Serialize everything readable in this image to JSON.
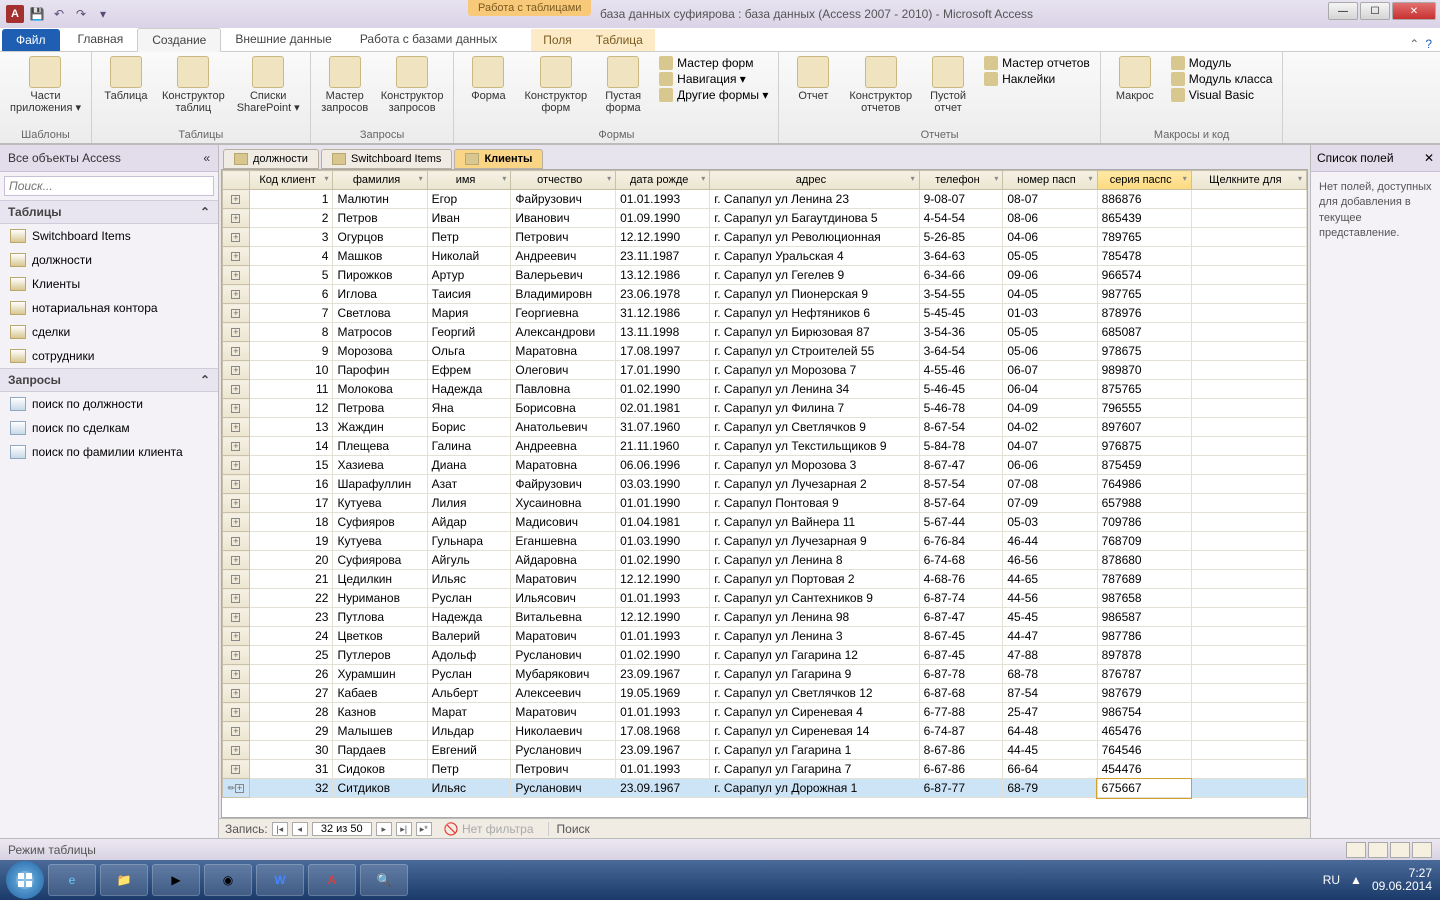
{
  "titlebar": {
    "app_letter": "A",
    "context_label": "Работа с таблицами",
    "title": "база данных суфиярова : база данных (Access 2007 - 2010)  -  Microsoft Access"
  },
  "tabs": {
    "file": "Файл",
    "items": [
      "Главная",
      "Создание",
      "Внешние данные",
      "Работа с базами данных"
    ],
    "active_index": 1,
    "context": [
      "Поля",
      "Таблица"
    ]
  },
  "ribbon": {
    "groups": [
      {
        "label": "Шаблоны",
        "buttons": [
          {
            "t": "Части\nприложения ▾"
          }
        ]
      },
      {
        "label": "Таблицы",
        "buttons": [
          {
            "t": "Таблица"
          },
          {
            "t": "Конструктор\nтаблиц"
          },
          {
            "t": "Списки\nSharePoint ▾"
          }
        ]
      },
      {
        "label": "Запросы",
        "buttons": [
          {
            "t": "Мастер\nзапросов"
          },
          {
            "t": "Конструктор\nзапросов"
          }
        ]
      },
      {
        "label": "Формы",
        "buttons": [
          {
            "t": "Форма"
          },
          {
            "t": "Конструктор\nформ"
          },
          {
            "t": "Пустая\nформа"
          }
        ],
        "stack": [
          "Мастер форм",
          "Навигация ▾",
          "Другие формы ▾"
        ]
      },
      {
        "label": "Отчеты",
        "buttons": [
          {
            "t": "Отчет"
          },
          {
            "t": "Конструктор\nотчетов"
          },
          {
            "t": "Пустой\nотчет"
          }
        ],
        "stack": [
          "Мастер отчетов",
          "Наклейки"
        ]
      },
      {
        "label": "Макросы и код",
        "buttons": [
          {
            "t": "Макрос"
          }
        ],
        "stack": [
          "Модуль",
          "Модуль класса",
          "Visual Basic"
        ]
      }
    ]
  },
  "nav": {
    "header": "Все объекты Access",
    "search_ph": "Поиск...",
    "cat_tables": "Таблицы",
    "tables": [
      "Switchboard Items",
      "должности",
      "Клиенты",
      "нотариальная контора",
      "сделки",
      "сотрудники"
    ],
    "cat_queries": "Запросы",
    "queries": [
      "поиск по должности",
      "поиск по сделкам",
      "поиск по фамилии клиента"
    ]
  },
  "doctabs": [
    "должности",
    "Switchboard Items",
    "Клиенты"
  ],
  "doctabs_active": 2,
  "columns": [
    "Код клиент",
    "фамилия",
    "имя",
    "отчество",
    "дата рожде",
    "адрес",
    "телефон",
    "номер пасп",
    "серия паспс",
    "Щелкните для"
  ],
  "sorted_col": 8,
  "rows": [
    [
      1,
      "Малютин",
      "Егор",
      "Файрузович",
      "01.01.1993",
      "г. Сапапул ул Ленина 23",
      "9-08-07",
      "08-07",
      "886876"
    ],
    [
      2,
      "Петров",
      "Иван",
      "Иванович",
      "01.09.1990",
      "г. Сарапул ул Багаутдинова 5",
      "4-54-54",
      "08-06",
      "865439"
    ],
    [
      3,
      "Огурцов",
      "Петр",
      "Петрович",
      "12.12.1990",
      "г. Сарапул ул Революционная",
      "5-26-85",
      "04-06",
      "789765"
    ],
    [
      4,
      "Машков",
      "Николай",
      "Андреевич",
      "23.11.1987",
      "г. Сарапул Уральская 4",
      "3-64-63",
      "05-05",
      "785478"
    ],
    [
      5,
      "Пирожков",
      "Артур",
      "Валерьевич",
      "13.12.1986",
      "г. Сарапул ул Гегелев 9",
      "6-34-66",
      "09-06",
      "966574"
    ],
    [
      6,
      "Иглова",
      "Таисия",
      "Владимировн",
      "23.06.1978",
      "г. Сарапул ул Пионерская 9",
      "3-54-55",
      "04-05",
      "987765"
    ],
    [
      7,
      "Светлова",
      "Мария",
      "Георгиевна",
      "31.12.1986",
      "г. Сарапул ул Нефтяников 6",
      "5-45-45",
      "01-03",
      "878976"
    ],
    [
      8,
      "Матросов",
      "Георгий",
      "Александрови",
      "13.11.1998",
      "г. Сарапул ул Бирюзовая 87",
      "3-54-36",
      "05-05",
      "685087"
    ],
    [
      9,
      "Морозова",
      "Ольга",
      "Маратовна",
      "17.08.1997",
      "г. Сарапул ул Строителей 55",
      "3-64-54",
      "05-06",
      "978675"
    ],
    [
      10,
      "Парофин",
      "Ефрем",
      "Олегович",
      "17.01.1990",
      "г. Сарапул ул Морозова 7",
      "4-55-46",
      "06-07",
      "989870"
    ],
    [
      11,
      "Молокова",
      "Надежда",
      "Павловна",
      "01.02.1990",
      "г. Сарапул ул Ленина 34",
      "5-46-45",
      "06-04",
      "875765"
    ],
    [
      12,
      "Петрова",
      "Яна",
      "Борисовна",
      "02.01.1981",
      "г. Сарапул ул Филина 7",
      "5-46-78",
      "04-09",
      "796555"
    ],
    [
      13,
      "Жаждин",
      "Борис",
      "Анатольевич",
      "31.07.1960",
      "г. Сарапул ул Светлячков 9",
      "8-67-54",
      "04-02",
      "897607"
    ],
    [
      14,
      "Плещева",
      "Галина",
      "Андреевна",
      "21.11.1960",
      "г. Сарапул ул Текстильщиков 9",
      "5-84-78",
      "04-07",
      "976875"
    ],
    [
      15,
      "Хазиева",
      "Диана",
      "Маратовна",
      "06.06.1996",
      "г. Сарапул ул Морозова 3",
      "8-67-47",
      "06-06",
      "875459"
    ],
    [
      16,
      "Шарафуллин",
      "Азат",
      "Файрузович",
      "03.03.1990",
      "г. Сарапул ул Лучезарная 2",
      "8-57-54",
      "07-08",
      "764986"
    ],
    [
      17,
      "Кутуева",
      "Лилия",
      "Хусаиновна",
      "01.01.1990",
      "г. Сарапул Понтовая 9",
      "8-57-64",
      "07-09",
      "657988"
    ],
    [
      18,
      "Суфияров",
      "Айдар",
      "Мадисович",
      "01.04.1981",
      "г. Сарапул ул Вайнера 11",
      "5-67-44",
      "05-03",
      "709786"
    ],
    [
      19,
      "Кутуева",
      "Гульнара",
      "Еганшевна",
      "01.03.1990",
      "г. Сарапул ул Лучезарная 9",
      "6-76-84",
      "46-44",
      "768709"
    ],
    [
      20,
      "Суфиярова",
      "Айгуль",
      "Айдаровна",
      "01.02.1990",
      "г. Сарапул ул Ленина 8",
      "6-74-68",
      "46-56",
      "878680"
    ],
    [
      21,
      "Цедилкин",
      "Ильяс",
      "Маратович",
      "12.12.1990",
      "г. Сарапул ул Портовая 2",
      "4-68-76",
      "44-65",
      "787689"
    ],
    [
      22,
      "Нуриманов",
      "Руслан",
      "Ильясович",
      "01.01.1993",
      "г. Сарапул ул Сантехников 9",
      "6-87-74",
      "44-56",
      "987658"
    ],
    [
      23,
      "Путлова",
      "Надежда",
      "Витальевна",
      "12.12.1990",
      "г. Сарапул ул Ленина 98",
      "6-87-47",
      "45-45",
      "986587"
    ],
    [
      24,
      "Цветков",
      "Валерий",
      "Маратович",
      "01.01.1993",
      "г. Сарапул ул Ленина 3",
      "8-67-45",
      "44-47",
      "987786"
    ],
    [
      25,
      "Путлеров",
      "Адольф",
      "Русланович",
      "01.02.1990",
      "г. Сарапул ул Гагарина 12",
      "6-87-45",
      "47-88",
      "897878"
    ],
    [
      26,
      "Хурамшин",
      "Руслан",
      "Мубарякович",
      "23.09.1967",
      "г. Сарапул ул Гагарина 9",
      "6-87-78",
      "68-78",
      "876787"
    ],
    [
      27,
      "Кабаев",
      "Альберт",
      "Алексеевич",
      "19.05.1969",
      "г. Сарапул ул Светлячков 12",
      "6-87-68",
      "87-54",
      "987679"
    ],
    [
      28,
      "Казнов",
      "Марат",
      "Маратович",
      "01.01.1993",
      "г. Сарапул ул Сиреневая 4",
      "6-77-88",
      "25-47",
      "986754"
    ],
    [
      29,
      "Малышев",
      "Ильдар",
      "Николаевич",
      "17.08.1968",
      "г. Сарапул ул Сиреневая 14",
      "6-74-87",
      "64-48",
      "465476"
    ],
    [
      30,
      "Пардаев",
      "Евгений",
      "Русланович",
      "23.09.1967",
      "г. Сарапул ул Гагарина 1",
      "8-67-86",
      "44-45",
      "764546"
    ],
    [
      31,
      "Сидоков",
      "Петр",
      "Петрович",
      "01.01.1993",
      "г. Сарапул ул Гагарина 7",
      "6-67-86",
      "66-64",
      "454476"
    ],
    [
      32,
      "Ситдиков",
      "Ильяс",
      "Русланович",
      "23.09.1967",
      "г. Сарапул ул Дорожная 1",
      "6-87-77",
      "68-79",
      "675667"
    ]
  ],
  "selected_row": 31,
  "recnav": {
    "label": "Запись:",
    "pos": "32 из 50",
    "filter": "Нет фильтра",
    "search": "Поиск"
  },
  "fieldlist": {
    "header": "Список полей",
    "body": "Нет полей, доступных для добавления в текущее представление."
  },
  "status": {
    "mode": "Режим таблицы"
  },
  "tray": {
    "lang": "RU",
    "time": "7:27",
    "date": "09.06.2014"
  }
}
